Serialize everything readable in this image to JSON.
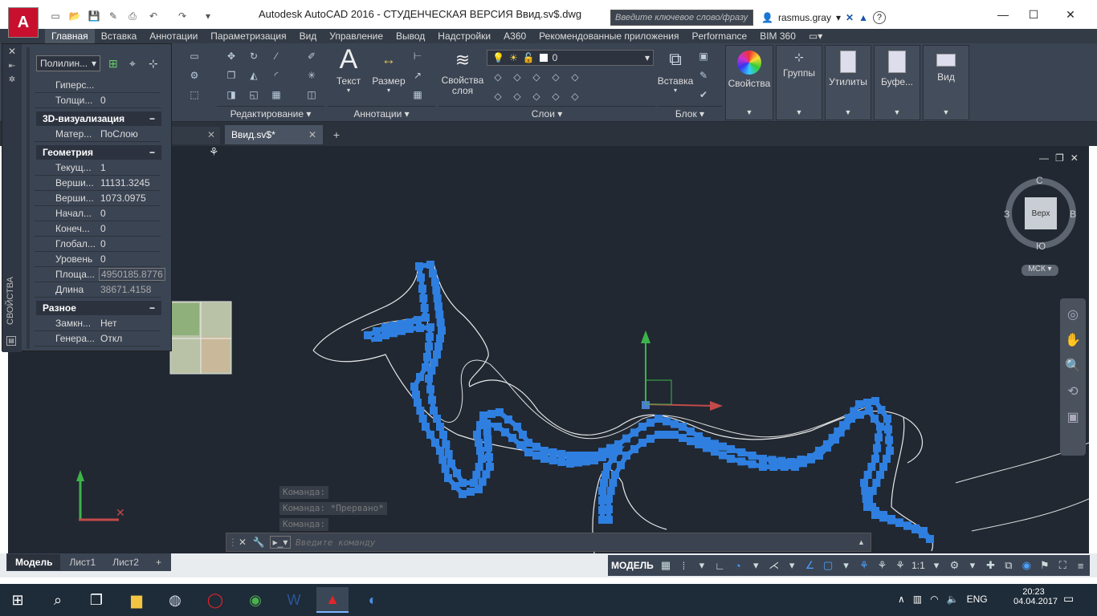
{
  "window": {
    "title": "Autodesk AutoCAD 2016 - СТУДЕНЧЕСКАЯ ВЕРСИЯ     Ввид.sv$.dwg",
    "search_placeholder": "Введите ключевое слово/фразу",
    "user": "rasmus.gray"
  },
  "ribbon_tabs": [
    "Главная",
    "Вставка",
    "Аннотации",
    "Параметризация",
    "Вид",
    "Управление",
    "Вывод",
    "Надстройки",
    "A360",
    "Рекомендованные приложения",
    "Performance",
    "BIM 360"
  ],
  "ribbon": {
    "panels": {
      "modify": "Редактирование",
      "annotation": "Аннотации",
      "layers": "Слои",
      "block": "Блок"
    },
    "buttons": {
      "text": "Текст",
      "dimension": "Размер",
      "layer_props": "Свойства слоя",
      "insert": "Вставка",
      "properties": "Свойства",
      "groups": "Группы",
      "utilities": "Утилиты",
      "clipboard": "Буфе...",
      "view": "Вид"
    },
    "layer_current": "0"
  },
  "doc_tabs": {
    "active": "Ввид.sv$*"
  },
  "properties": {
    "strip_label": "СВОЙСТВА",
    "object_type": "Полилин...",
    "rows_top": [
      {
        "k": "Гиперс...",
        "v": ""
      },
      {
        "k": "Толщи...",
        "v": "0"
      }
    ],
    "sec_3d": "3D-визуализация",
    "rows_3d": [
      {
        "k": "Матер...",
        "v": "ПоСлою"
      }
    ],
    "sec_geom": "Геометрия",
    "rows_geom": [
      {
        "k": "Текущ...",
        "v": "1"
      },
      {
        "k": "Верши...",
        "v": "11131.3245"
      },
      {
        "k": "Верши...",
        "v": "1073.0975"
      },
      {
        "k": "Начал...",
        "v": "0"
      },
      {
        "k": "Конеч...",
        "v": "0"
      },
      {
        "k": "Глобал...",
        "v": "0"
      },
      {
        "k": "Уровень",
        "v": "0"
      },
      {
        "k": "Площа...",
        "v": "4950185.8776"
      },
      {
        "k": "Длина",
        "v": "38671.4158"
      }
    ],
    "sec_misc": "Разное",
    "rows_misc": [
      {
        "k": "Замкн...",
        "v": "Нет"
      },
      {
        "k": "Генера...",
        "v": "Откл"
      }
    ]
  },
  "viewcube": {
    "n": "С",
    "s": "Ю",
    "w": "З",
    "e": "В",
    "face": "Верх",
    "ucs": "МСК"
  },
  "command": {
    "history": [
      "Команда:",
      "Команда: *Прервано*",
      "Команда:"
    ],
    "placeholder": "Введите команду"
  },
  "layout_tabs": [
    "Модель",
    "Лист1",
    "Лист2"
  ],
  "status": {
    "model": "МОДЕЛЬ",
    "scale": "1:1"
  },
  "taskbar": {
    "lang": "ENG",
    "time": "20:23",
    "date": "04.04.2017"
  }
}
